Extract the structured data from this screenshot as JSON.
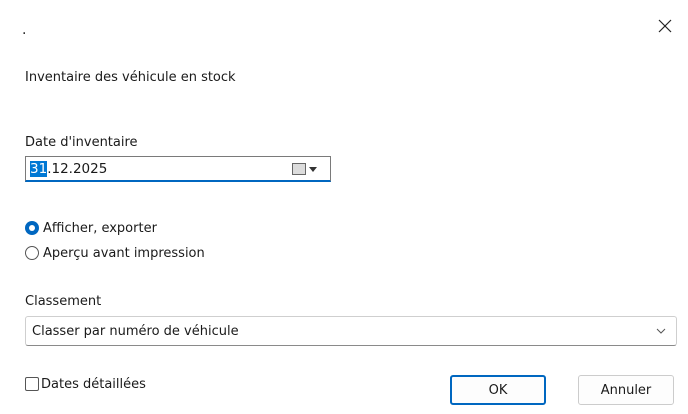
{
  "window": {
    "title": ".",
    "close_icon": "close-icon"
  },
  "heading": "Inventaire des véhicule en stock",
  "date": {
    "label": "Date d'inventaire",
    "day": "31",
    "rest": ".12.2025",
    "calendar_icon": "calendar-icon",
    "dropdown_icon": "chevron-down-icon"
  },
  "output_options": [
    {
      "label": "Afficher, exporter",
      "checked": true
    },
    {
      "label": "Aperçu avant impression",
      "checked": false
    }
  ],
  "sort": {
    "label": "Classement",
    "value": "Classer par numéro de véhicule"
  },
  "detailed_dates": {
    "label": "Dates détaillées",
    "checked": false
  },
  "buttons": {
    "ok": "OK",
    "cancel": "Annuler"
  },
  "colors": {
    "accent": "#0067c0",
    "selection": "#0078d4"
  }
}
